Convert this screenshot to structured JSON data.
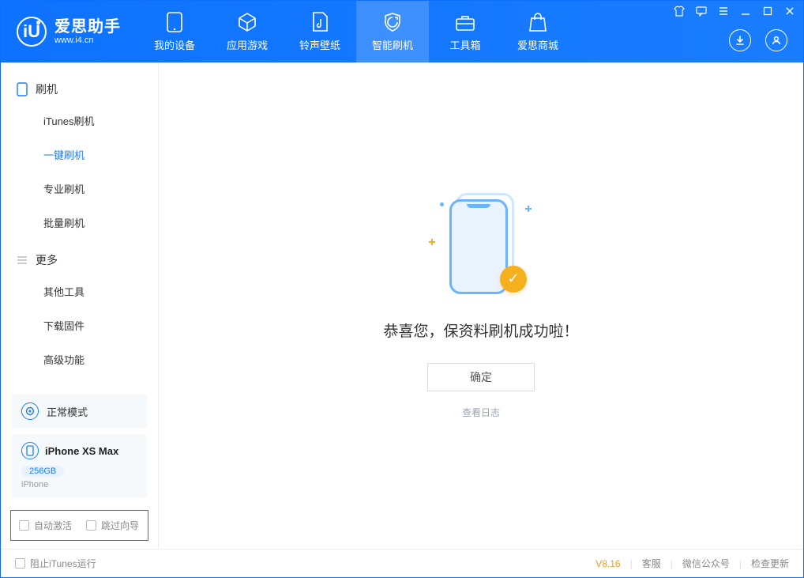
{
  "app": {
    "name_cn": "爱思助手",
    "name_en": "www.i4.cn"
  },
  "nav": {
    "items": [
      {
        "label": "我的设备",
        "icon": "device"
      },
      {
        "label": "应用游戏",
        "icon": "cube"
      },
      {
        "label": "铃声壁纸",
        "icon": "music"
      },
      {
        "label": "智能刷机",
        "icon": "shield"
      },
      {
        "label": "工具箱",
        "icon": "toolbox"
      },
      {
        "label": "爱思商城",
        "icon": "bag"
      }
    ],
    "active_index": 3
  },
  "sidebar": {
    "section1": {
      "title": "刷机"
    },
    "items1": [
      {
        "label": "iTunes刷机"
      },
      {
        "label": "一键刷机"
      },
      {
        "label": "专业刷机"
      },
      {
        "label": "批量刷机"
      }
    ],
    "active_index1": 1,
    "section2": {
      "title": "更多"
    },
    "items2": [
      {
        "label": "其他工具"
      },
      {
        "label": "下载固件"
      },
      {
        "label": "高级功能"
      }
    ],
    "mode_card": {
      "label": "正常模式"
    },
    "device_card": {
      "name": "iPhone XS Max",
      "capacity": "256GB",
      "type": "iPhone"
    },
    "checkboxes": {
      "auto_activate": "自动激活",
      "skip_guide": "跳过向导"
    }
  },
  "main": {
    "success_message": "恭喜您，保资料刷机成功啦！",
    "ok_button": "确定",
    "view_log": "查看日志"
  },
  "footer": {
    "block_itunes": "阻止iTunes运行",
    "version": "V8.16",
    "links": {
      "support": "客服",
      "wechat": "微信公众号",
      "check_update": "检查更新"
    }
  }
}
